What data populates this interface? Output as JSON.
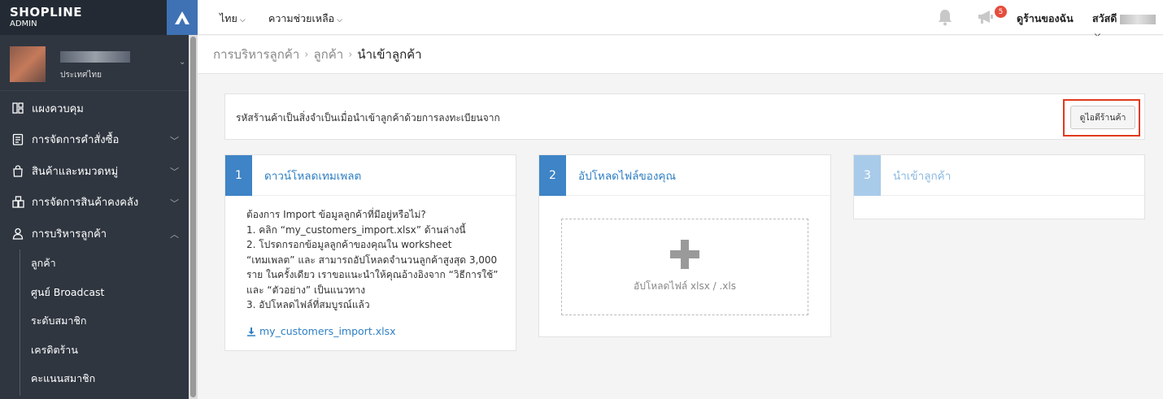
{
  "brand": {
    "logo": "SHOPLINE",
    "sub": "ADMIN"
  },
  "profile": {
    "country": "ประเทศไทย"
  },
  "sidebar": {
    "items": [
      {
        "label": "แผงควบคุม",
        "icon": "dashboard-icon"
      },
      {
        "label": "การจัดการคำสั่งซื้อ",
        "icon": "clipboard-icon"
      },
      {
        "label": "สินค้าและหมวดหมู่",
        "icon": "bag-icon"
      },
      {
        "label": "การจัดการสินค้าคงคลัง",
        "icon": "warehouse-icon"
      },
      {
        "label": "การบริหารลูกค้า",
        "icon": "user-icon"
      }
    ],
    "sub_items": [
      "ลูกค้า",
      "ศูนย์ Broadcast",
      "ระดับสมาชิก",
      "เครดิตร้าน",
      "คะแนนสมาชิก"
    ]
  },
  "topbar": {
    "language": "ไทย",
    "help": "ความช่วยเหลือ",
    "notif_count": "5",
    "view_store": "ดูร้านของฉัน",
    "greeting": "สวัสดี"
  },
  "breadcrumb": [
    "การบริหารลูกค้า",
    "ลูกค้า",
    "นำเข้าลูกค้า"
  ],
  "notice": {
    "text": "รหัสร้านค้าเป็นสิ่งจำเป็นเมื่อนำเข้าลูกค้าด้วยการลงทะเบียนจาก",
    "button": "ดูไอดีร้านค้า"
  },
  "steps": [
    {
      "num": "1",
      "title": "ดาวน์โหลดเทมเพลต",
      "lines": [
        "ต้องการ Import ข้อมูลลูกค้าที่มีอยู่หรือไม่?",
        "1. คลิก “my_customers_import.xlsx” ด้านล่างนี้",
        "2. โปรดกรอกข้อมูลลูกค้าของคุณใน worksheet",
        "“เทมเพลต” และ สามารถอัปโหลดจำนวนลูกค้าสูงสุด 3,000",
        "ราย ในครั้งเดียว เราขอแนะนำให้คุณอ้างอิงจาก “วิธีการใช้”",
        "และ “ตัวอย่าง” เป็นแนวทาง",
        "3. อัปโหลดไฟล์ที่สมบูรณ์แล้ว"
      ],
      "download": "my_customers_import.xlsx"
    },
    {
      "num": "2",
      "title": "อัปโหลดไฟล์ของคุณ",
      "drop_text": "อัปโหลดไฟล์ xlsx / .xls"
    },
    {
      "num": "3",
      "title": "นำเข้าลูกค้า"
    }
  ]
}
